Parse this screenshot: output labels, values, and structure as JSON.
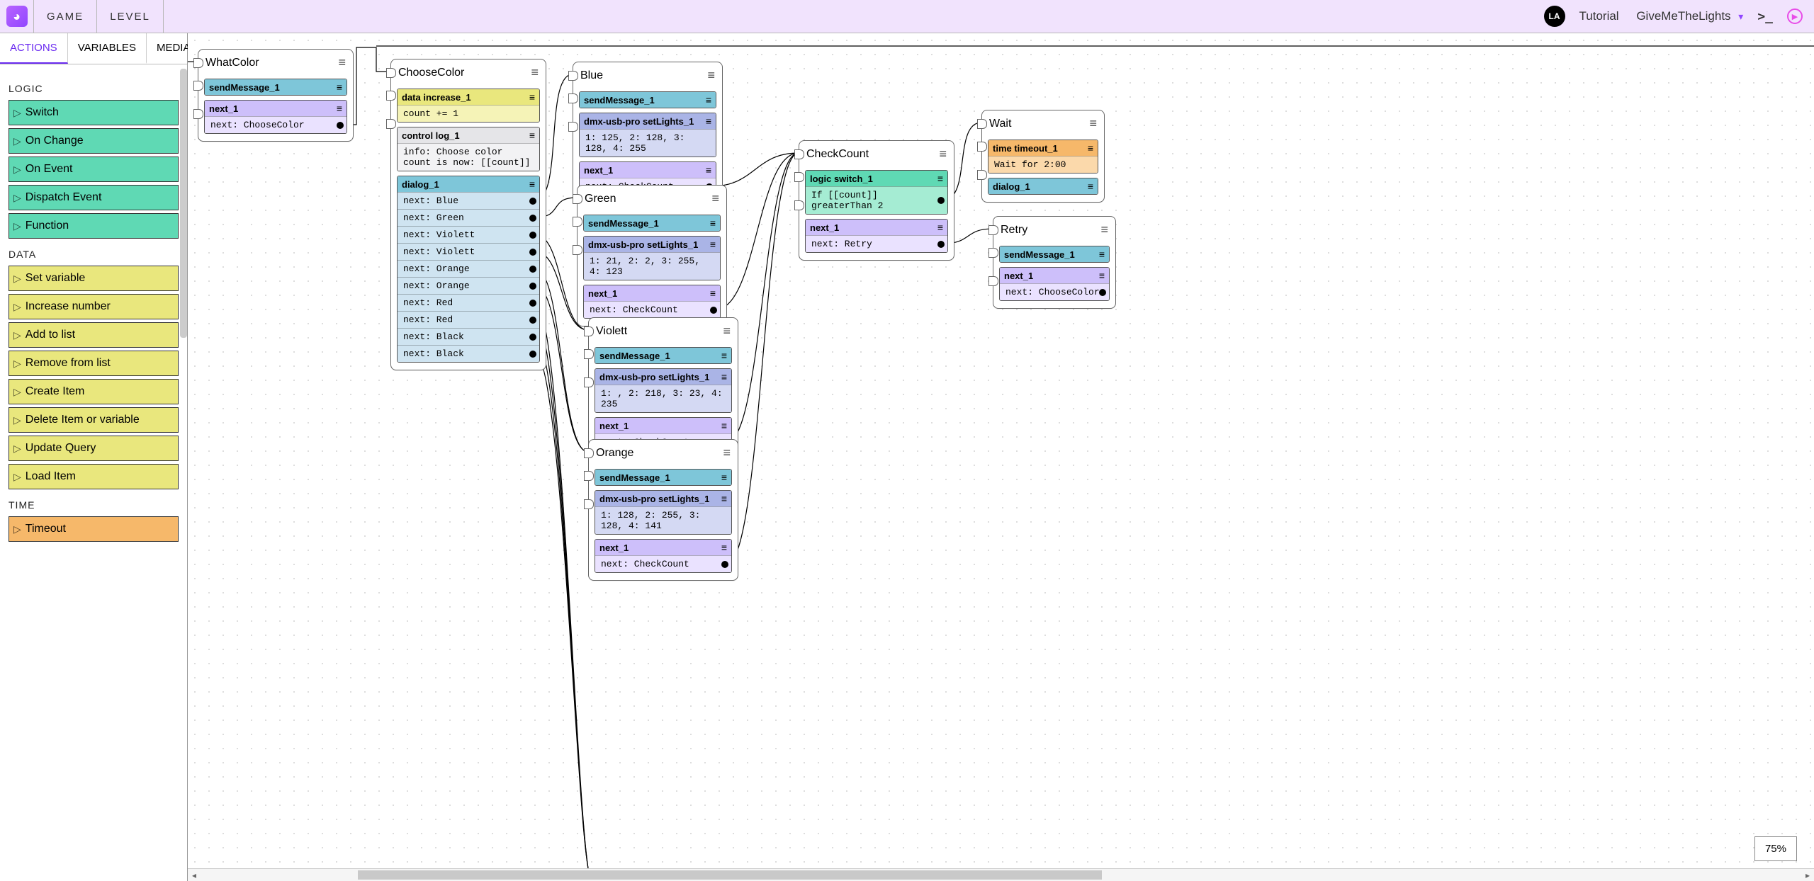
{
  "topbar": {
    "menu_game": "GAME",
    "menu_level": "LEVEL",
    "avatar": "LA",
    "crumb1": "Tutorial",
    "crumb2": "GiveMeTheLights"
  },
  "sidebar": {
    "tabs": [
      {
        "id": "actions",
        "label": "ACTIONS",
        "active": true
      },
      {
        "id": "variables",
        "label": "VARIABLES",
        "active": false
      },
      {
        "id": "media",
        "label": "MEDIA",
        "active": false
      }
    ],
    "sections": [
      {
        "title": "LOGIC",
        "color": "logic",
        "items": [
          "Switch",
          "On Change",
          "On Event",
          "Dispatch Event",
          "Function"
        ]
      },
      {
        "title": "DATA",
        "color": "data",
        "items": [
          "Set variable",
          "Increase number",
          "Add to list",
          "Remove from list",
          "Create Item",
          "Delete Item or variable",
          "Update Query",
          "Load Item"
        ]
      },
      {
        "title": "TIME",
        "color": "time",
        "items": [
          "Timeout"
        ]
      }
    ]
  },
  "canvas": {
    "zoom": "75%"
  },
  "nodes": {
    "whatcolor": {
      "title": "WhatColor",
      "rows": [
        {
          "kind": "send",
          "label": "sendMessage_1"
        },
        {
          "kind": "next",
          "label": "next_1",
          "sub": "next: ChooseColor"
        }
      ]
    },
    "choosecolor": {
      "title": "ChooseColor",
      "rows": [
        {
          "kind": "data",
          "label": "data increase_1",
          "sub": "count += 1"
        },
        {
          "kind": "ctrl",
          "label": "control log_1",
          "sub": "info: Choose color count is now: [[count]]"
        },
        {
          "kind": "dialog",
          "label": "dialog_1",
          "options": [
            "next: Blue",
            "next: Green",
            "next: Violett",
            "next: Violett",
            "next: Orange",
            "next: Orange",
            "next: Red",
            "next: Red",
            "next: Black",
            "next: Black"
          ]
        }
      ]
    },
    "blue": {
      "title": "Blue",
      "rows": [
        {
          "kind": "send",
          "label": "sendMessage_1"
        },
        {
          "kind": "dmx",
          "label": "dmx-usb-pro setLights_1",
          "sub": "1: 125, 2: 128, 3: 128, 4: 255"
        },
        {
          "kind": "next",
          "label": "next_1",
          "sub": "next: CheckCount"
        }
      ]
    },
    "green": {
      "title": "Green",
      "rows": [
        {
          "kind": "send",
          "label": "sendMessage_1"
        },
        {
          "kind": "dmx",
          "label": "dmx-usb-pro setLights_1",
          "sub": "1: 21, 2: 2, 3: 255, 4: 123"
        },
        {
          "kind": "next",
          "label": "next_1",
          "sub": "next: CheckCount"
        }
      ]
    },
    "violett": {
      "title": "Violett",
      "rows": [
        {
          "kind": "send",
          "label": "sendMessage_1"
        },
        {
          "kind": "dmx",
          "label": "dmx-usb-pro setLights_1",
          "sub": "1: , 2: 218, 3: 23, 4: 235"
        },
        {
          "kind": "next",
          "label": "next_1",
          "sub": "next: CheckCount"
        }
      ]
    },
    "orange": {
      "title": "Orange",
      "rows": [
        {
          "kind": "send",
          "label": "sendMessage_1"
        },
        {
          "kind": "dmx",
          "label": "dmx-usb-pro setLights_1",
          "sub": "1: 128, 2: 255, 3: 128, 4: 141"
        },
        {
          "kind": "next",
          "label": "next_1",
          "sub": "next: CheckCount"
        }
      ]
    },
    "checkcount": {
      "title": "CheckCount",
      "rows": [
        {
          "kind": "logic",
          "label": "logic switch_1",
          "sub": "If [[count]] greaterThan 2"
        },
        {
          "kind": "next",
          "label": "next_1",
          "sub": "next: Retry"
        }
      ]
    },
    "wait": {
      "title": "Wait",
      "rows": [
        {
          "kind": "time",
          "label": "time timeout_1",
          "sub": "Wait for 2:00"
        },
        {
          "kind": "dialog",
          "label": "dialog_1"
        }
      ]
    },
    "retry": {
      "title": "Retry",
      "rows": [
        {
          "kind": "send",
          "label": "sendMessage_1"
        },
        {
          "kind": "next",
          "label": "next_1",
          "sub": "next: ChooseColor"
        }
      ]
    }
  }
}
